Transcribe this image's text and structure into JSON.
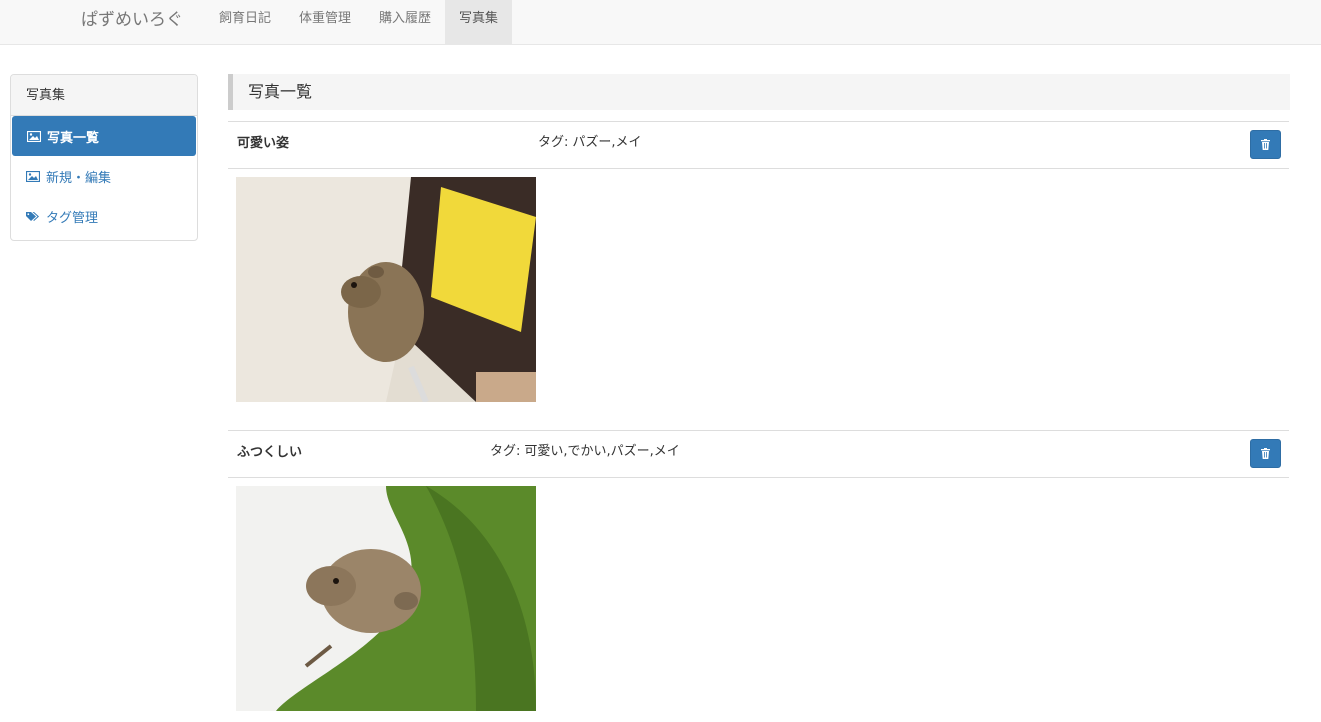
{
  "navbar": {
    "brand": "ぱずめいろぐ",
    "items": [
      {
        "label": "飼育日記",
        "active": false
      },
      {
        "label": "体重管理",
        "active": false
      },
      {
        "label": "購入履歴",
        "active": false
      },
      {
        "label": "写真集",
        "active": true
      }
    ]
  },
  "sidebar": {
    "heading": "写真集",
    "items": [
      {
        "label": "写真一覧",
        "icon": "image-icon",
        "active": true
      },
      {
        "label": "新規・編集",
        "icon": "image-icon",
        "active": false
      },
      {
        "label": "タグ管理",
        "icon": "tags-icon",
        "active": false
      }
    ]
  },
  "main": {
    "title": "写真一覧",
    "tag_prefix": "タグ:",
    "entries": [
      {
        "title": "可愛い姿",
        "tags": "パズー,メイ",
        "delete_icon": "trash-icon"
      },
      {
        "title": "ふつくしい",
        "tags": "可愛い,でかい,パズー,メイ",
        "delete_icon": "trash-icon"
      }
    ]
  },
  "colors": {
    "primary": "#337ab7",
    "navbar_bg": "#f8f8f8",
    "active_nav_bg": "#e7e7e7",
    "header_bg": "#f5f5f5"
  }
}
